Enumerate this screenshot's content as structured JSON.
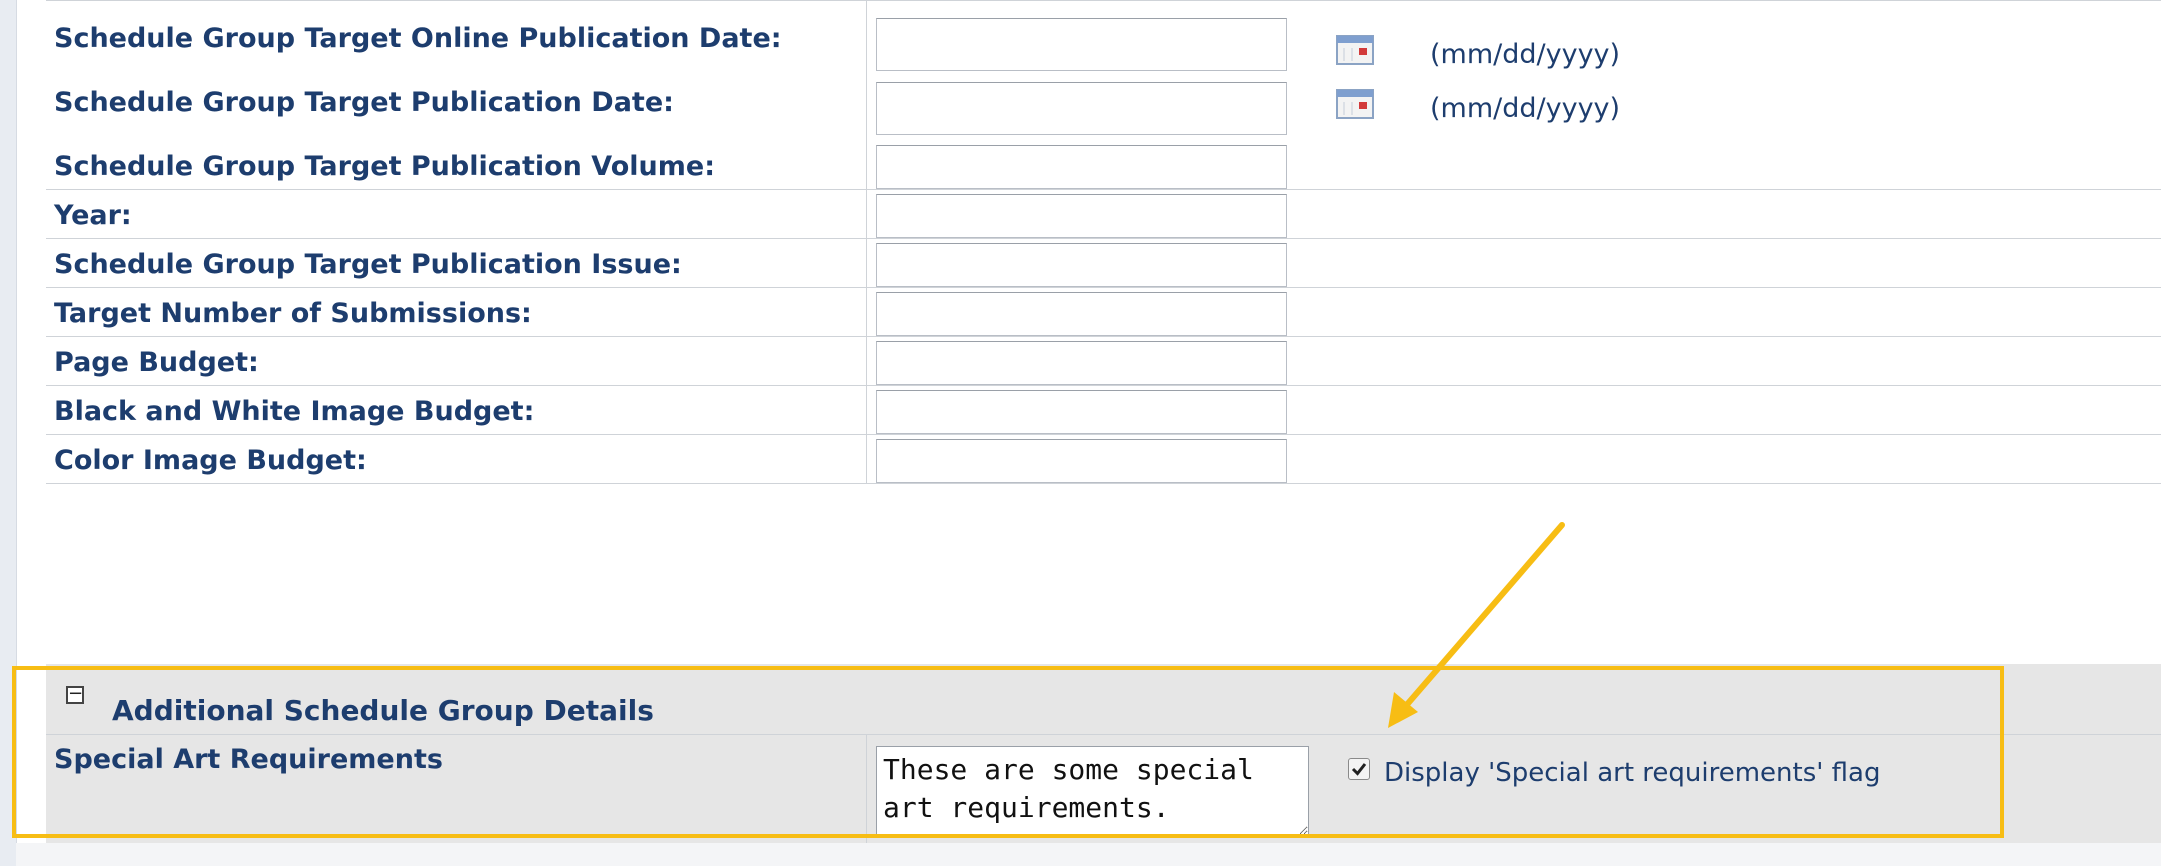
{
  "form": {
    "rows": [
      {
        "label": "Schedule Group Target Online Publication Date:",
        "value": "",
        "has_calendar": true,
        "hint": "(mm/dd/yyyy)"
      },
      {
        "label": "Schedule Group Target Publication Date:",
        "value": "",
        "has_calendar": true,
        "hint": "(mm/dd/yyyy)"
      },
      {
        "label": "Schedule Group Target Publication Volume:",
        "value": ""
      },
      {
        "label": "Year:",
        "value": ""
      },
      {
        "label": "Schedule Group Target Publication Issue:",
        "value": ""
      },
      {
        "label": "Target Number of Submissions:",
        "value": ""
      },
      {
        "label": "Page Budget:",
        "value": ""
      },
      {
        "label": "Black and White Image Budget:",
        "value": ""
      },
      {
        "label": "Color Image Budget:",
        "value": ""
      }
    ]
  },
  "section": {
    "collapse_icon": "minus-box-icon",
    "title": "Additional Schedule Group Details",
    "special_art": {
      "label": "Special Art Requirements",
      "textarea_value": "These are some special art requirements.",
      "checkbox_checked": true,
      "checkbox_label": "Display 'Special art requirements' flag"
    }
  },
  "annotation": {
    "highlight_color": "#f7bd14",
    "arrow_icon": "callout-arrow-icon"
  },
  "icons": {
    "calendar": "calendar-icon"
  }
}
